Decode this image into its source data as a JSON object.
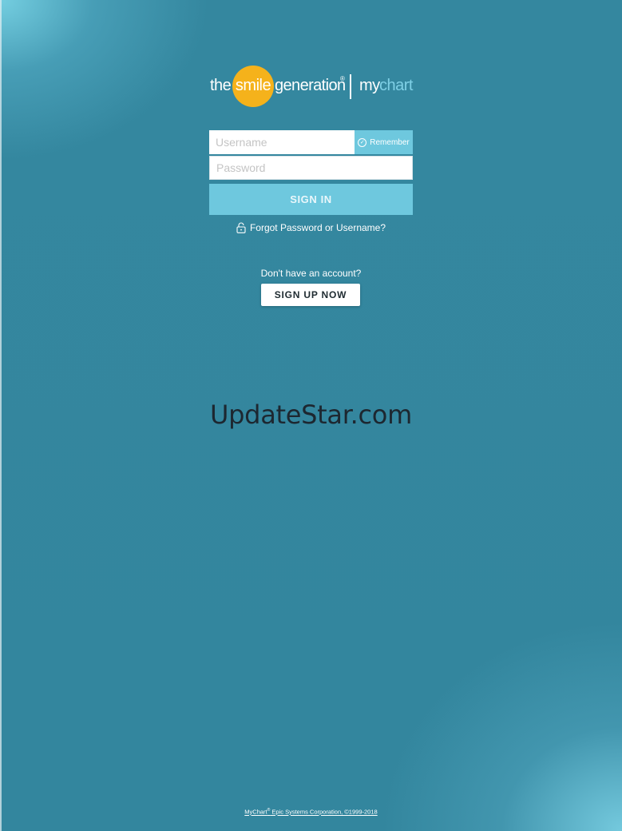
{
  "logo": {
    "the": "the",
    "smile": "smile",
    "generation": "generation",
    "registered": "®",
    "my": "my",
    "chart": "chart"
  },
  "login": {
    "username_placeholder": "Username",
    "password_placeholder": "Password",
    "remember_label": "Remember",
    "signin_label": "SIGN IN",
    "forgot_label": "Forgot Password or Username?"
  },
  "signup": {
    "prompt": "Don't have an account?",
    "button_label": "SIGN UP NOW"
  },
  "watermark": "UpdateStar.com",
  "footer": {
    "brand": "MyChart",
    "mark": "®",
    "text": " Epic Systems Corporation, ©1999-2018"
  },
  "colors": {
    "background": "#34879f",
    "accent": "#6ec8de",
    "logo_circle": "#f5b21b"
  },
  "icons": {
    "remember": "check-circle-icon",
    "forgot": "lock-icon"
  }
}
